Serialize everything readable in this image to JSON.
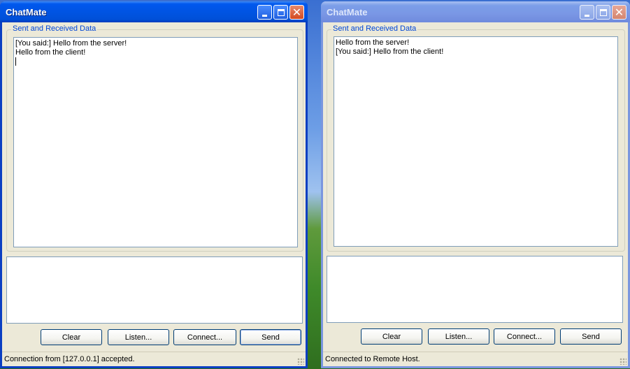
{
  "windows": [
    {
      "title": "ChatMate",
      "group_label": "Sent and Received Data",
      "messages": [
        "[You said:] Hello from the server!",
        "Hello from the client!"
      ],
      "input_value": "",
      "buttons": {
        "clear": "Clear",
        "listen": "Listen...",
        "connect": "Connect...",
        "send": "Send"
      },
      "status": "Connection from [127.0.0.1] accepted."
    },
    {
      "title": "ChatMate",
      "group_label": "Sent and Received Data",
      "messages": [
        "Hello from the server!",
        "[You said:] Hello from the client!"
      ],
      "input_value": "",
      "buttons": {
        "clear": "Clear",
        "listen": "Listen...",
        "connect": "Connect...",
        "send": "Send"
      },
      "status": "Connected to Remote Host."
    }
  ],
  "titlebar_icons": [
    "minimize-icon",
    "maximize-icon",
    "close-icon"
  ],
  "colors": {
    "titlebar_active": "#0054e3",
    "titlebar_inactive": "#7a97e5",
    "group_label": "#0046d5",
    "window_bg": "#ece9d8"
  }
}
